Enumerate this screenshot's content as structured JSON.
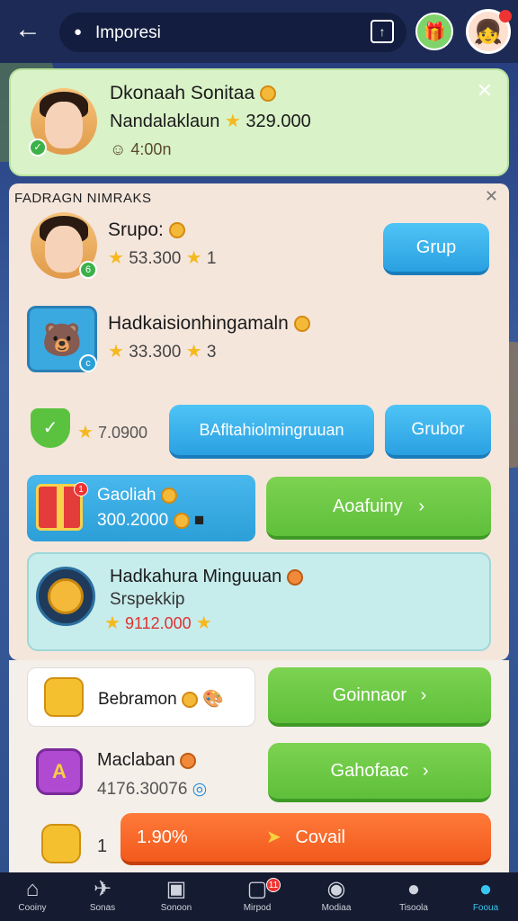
{
  "header": {
    "back_icon": "arrow-left-icon",
    "search_title": "Imporesi",
    "gift_icon": "gift-icon",
    "avatar_icon": "avatar-icon"
  },
  "profile_card": {
    "name": "Dkonaah Sonitaa",
    "subtitle": "Nandalaklaun",
    "points": "329.000",
    "timer": "4:00n"
  },
  "panel": {
    "heading": "FADRAGN NIMRAKS",
    "rows": [
      {
        "title": "Srupo:",
        "value": "53.300",
        "suffix": "1",
        "button": "Grup"
      },
      {
        "title": "Hadkaisionhingamaln",
        "value": "33.300",
        "suffix": "3"
      }
    ],
    "row3": {
      "value": "7.0900",
      "button_left": "BAfltahiolmingruuan",
      "button_right": "Grubor"
    },
    "gift": {
      "title": "Gaoliah",
      "value": "300.2000",
      "badge": "1",
      "button": "Aoafuiny"
    },
    "weekly": {
      "title": "Hadkahura Minguuan",
      "subtitle": "Srspekkip",
      "value": "9112.000"
    }
  },
  "lower": {
    "item1": {
      "title": "Bebramon",
      "button": "Goinnaor"
    },
    "item2": {
      "title": "Maclaban",
      "value": "4176.30076",
      "button": "Gahofaac",
      "icon_letter": "A"
    },
    "item3": {
      "label": "1",
      "progress_text": "1.90%",
      "button": "Covail"
    }
  },
  "nav": [
    {
      "label": "Cooiny",
      "icon": "home-icon"
    },
    {
      "label": "Sonas",
      "icon": "plane-icon"
    },
    {
      "label": "Sonoon",
      "icon": "shop-icon"
    },
    {
      "label": "Mirpod",
      "icon": "video-icon",
      "badge": "11"
    },
    {
      "label": "Modiaa",
      "icon": "chat-icon"
    },
    {
      "label": "Tisoola",
      "icon": "message-icon"
    },
    {
      "label": "Fooua",
      "icon": "globe-icon"
    }
  ],
  "colors": {
    "accent_blue": "#2aa0e2",
    "accent_green": "#5fbf3a",
    "accent_orange": "#f25a1c",
    "nav_active": "#37c6f0"
  }
}
